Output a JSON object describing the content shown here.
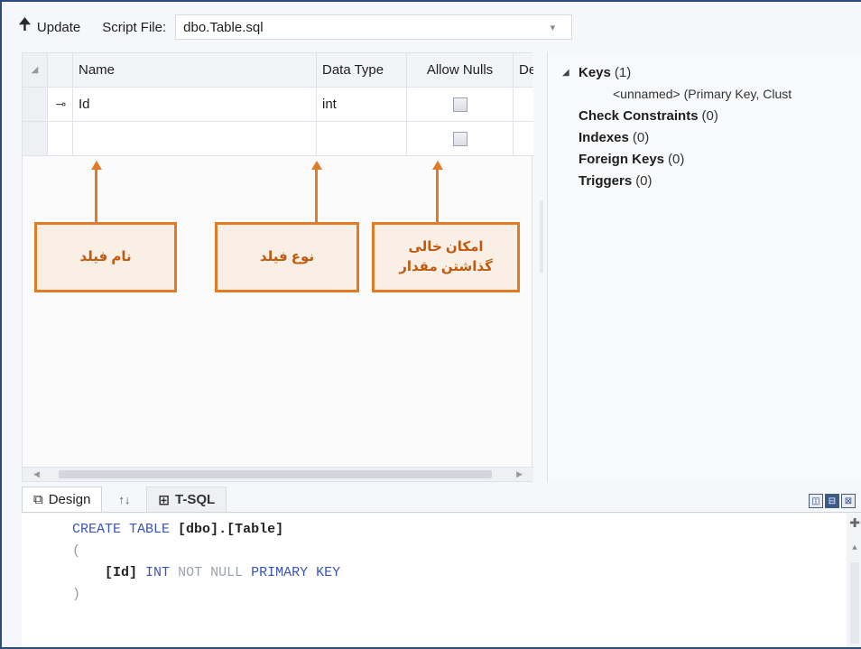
{
  "toolbar": {
    "update_label": "Update",
    "script_file_label": "Script File:",
    "script_file_value": "dbo.Table.sql"
  },
  "grid": {
    "columns": [
      "Name",
      "Data Type",
      "Allow Nulls",
      "Defa"
    ],
    "rows": [
      {
        "name": "Id",
        "type": "int",
        "allow_nulls": false,
        "is_key": true
      },
      {
        "name": "",
        "type": "",
        "allow_nulls": false,
        "is_key": false
      }
    ]
  },
  "annotations": {
    "field_name": "نام فیلد",
    "field_type": "نوع فیلد",
    "allow_nulls_line1": "امکان خالی",
    "allow_nulls_line2": "گذاشتن مقدار",
    "color": "#e07c28"
  },
  "properties": {
    "keys_label": "Keys",
    "keys_count": "(1)",
    "key_child": "<unnamed>  (Primary Key, Clust",
    "check_label": "Check Constraints",
    "check_count": "(0)",
    "indexes_label": "Indexes",
    "indexes_count": "(0)",
    "fk_label": "Foreign Keys",
    "fk_count": "(0)",
    "triggers_label": "Triggers",
    "triggers_count": "(0)"
  },
  "tabs": {
    "design": "Design",
    "swap": "↑↓",
    "tsql": "T-SQL"
  },
  "sql": {
    "create": "CREATE TABLE",
    "dbo": "[dbo]",
    "dot": ".",
    "table": "[Table]",
    "open": "(",
    "col_name": "[Id]",
    "col_type": "INT",
    "not_null": "NOT NULL",
    "pk": "PRIMARY KEY",
    "close": ")"
  }
}
